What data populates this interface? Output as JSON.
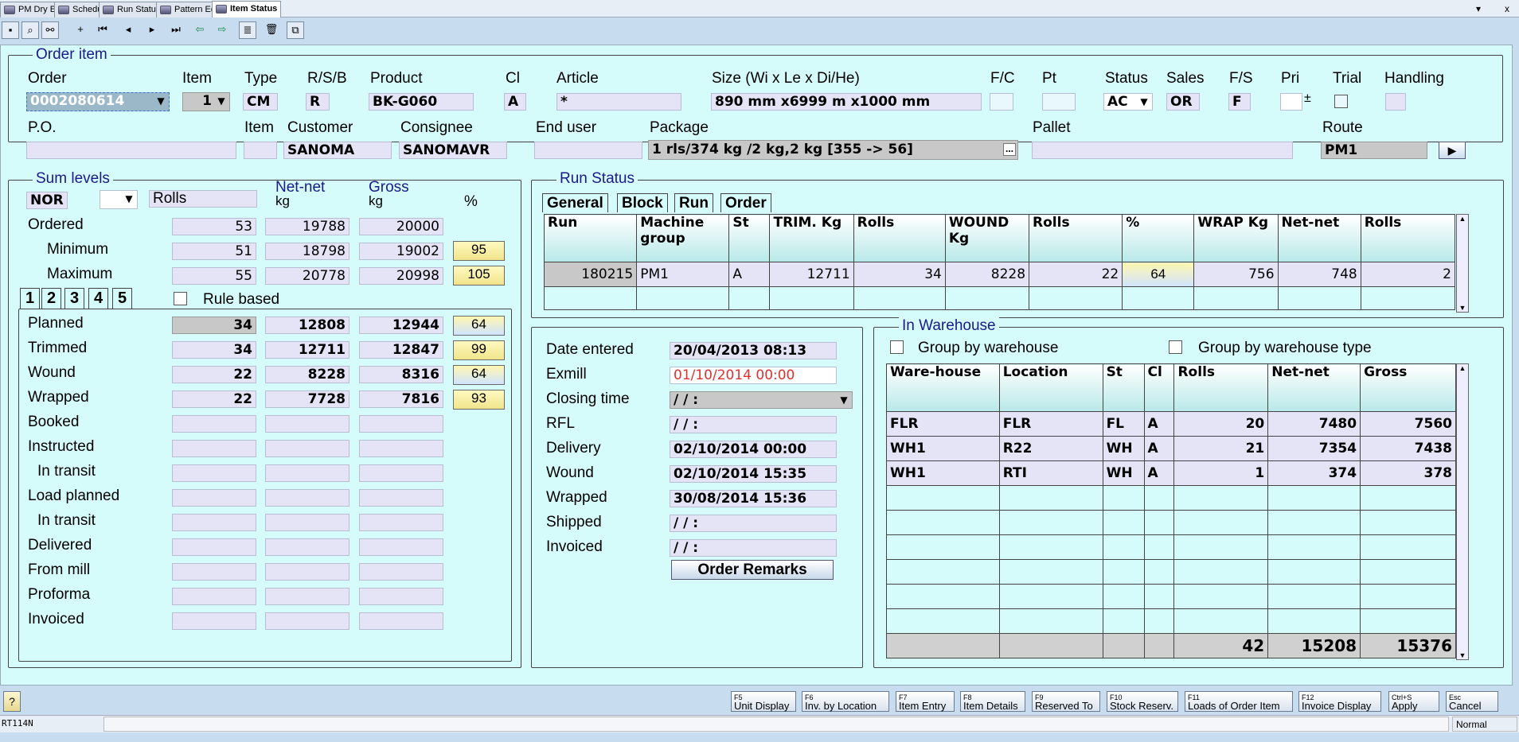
{
  "window_tabs": [
    "PM Dry End",
    "Schedule",
    "Run Status",
    "Pattern Edit",
    "Item Status"
  ],
  "window_controls": [
    "▾",
    "x"
  ],
  "toolbar": {
    "icons": [
      "save-icon",
      "find-icon",
      "binoculars-icon",
      "add-icon",
      "first-icon",
      "prev-icon",
      "next-icon",
      "last-icon",
      "back-icon",
      "forward-icon",
      "report-icon",
      "delete-icon",
      "copy-icon"
    ]
  },
  "order_item": {
    "title": "Order item",
    "labels": {
      "order": "Order",
      "item": "Item",
      "type": "Type",
      "rsb": "R/S/B",
      "product": "Product",
      "cl": "Cl",
      "article": "Article",
      "size": "Size (Wi x Le x Di/He)",
      "fc": "F/C",
      "pt": "Pt",
      "status": "Status",
      "sales": "Sales",
      "fs": "F/S",
      "pri": "Pri",
      "trial": "Trial",
      "handling": "Handling",
      "po": "P.O.",
      "item2": "Item",
      "customer": "Customer",
      "consignee": "Consignee",
      "end_user": "End user",
      "package": "Package",
      "pallet": "Pallet",
      "route": "Route"
    },
    "values": {
      "order": "0002080614",
      "item": "1",
      "type": "CM",
      "rsb": "R",
      "product": "BK-G060",
      "cl": "A",
      "article": "*",
      "size": "890 mm x6999 m x1000 mm",
      "fc": "",
      "pt": "",
      "status": "AC",
      "sales": "OR",
      "fs": "F",
      "pri": "",
      "handling": "",
      "po": "",
      "item2": "",
      "customer": "SANOMA",
      "consignee": "SANOMAVR",
      "end_user": "",
      "package": "1 rls/374 kg /2 kg,2 kg [355 -> 56]",
      "pallet": "",
      "route": "PM1"
    }
  },
  "sum_levels": {
    "title": "Sum levels",
    "code": "NOR",
    "unit": "Rolls",
    "col_netnet": "Net-net",
    "col_gross": "Gross",
    "unit_kg": "kg",
    "col_pct": "%",
    "rows_top": [
      {
        "label": "Ordered",
        "rolls": "53",
        "net": "19788",
        "gross": "20000",
        "pct": ""
      },
      {
        "label": "Minimum",
        "rolls": "51",
        "net": "18798",
        "gross": "19002",
        "pct": "95"
      },
      {
        "label": "Maximum",
        "rolls": "55",
        "net": "20778",
        "gross": "20998",
        "pct": "105"
      }
    ],
    "tabs": [
      "1",
      "2",
      "3",
      "4",
      "5"
    ],
    "rule_based": "Rule based",
    "rows": [
      {
        "label": "Planned",
        "rolls": "34",
        "net": "12808",
        "gross": "12944",
        "pct": "64"
      },
      {
        "label": "Trimmed",
        "rolls": "34",
        "net": "12711",
        "gross": "12847",
        "pct": "99"
      },
      {
        "label": "Wound",
        "rolls": "22",
        "net": "8228",
        "gross": "8316",
        "pct": "64"
      },
      {
        "label": "Wrapped",
        "rolls": "22",
        "net": "7728",
        "gross": "7816",
        "pct": "93"
      },
      {
        "label": "Booked",
        "rolls": "",
        "net": "",
        "gross": "",
        "pct": ""
      },
      {
        "label": "Instructed",
        "rolls": "",
        "net": "",
        "gross": "",
        "pct": ""
      },
      {
        "label": "In transit",
        "rolls": "",
        "net": "",
        "gross": "",
        "pct": ""
      },
      {
        "label": "Load planned",
        "rolls": "",
        "net": "",
        "gross": "",
        "pct": ""
      },
      {
        "label": "In transit",
        "rolls": "",
        "net": "",
        "gross": "",
        "pct": ""
      },
      {
        "label": "Delivered",
        "rolls": "",
        "net": "",
        "gross": "",
        "pct": ""
      },
      {
        "label": "From mill",
        "rolls": "",
        "net": "",
        "gross": "",
        "pct": ""
      },
      {
        "label": "Proforma",
        "rolls": "",
        "net": "",
        "gross": "",
        "pct": ""
      },
      {
        "label": "Invoiced",
        "rolls": "",
        "net": "",
        "gross": "",
        "pct": ""
      }
    ]
  },
  "run_status": {
    "title": "Run Status",
    "tabs": [
      "General",
      "Block",
      "Run",
      "Order"
    ],
    "columns": [
      "Run",
      "Machine group",
      "St",
      "TRIM. Kg",
      "Rolls",
      "WOUND Kg",
      "Rolls",
      "%",
      "WRAP Kg",
      "Net-net",
      "Rolls"
    ],
    "rows": [
      [
        "180215",
        "PM1",
        "A",
        "12711",
        "34",
        "8228",
        "22",
        "64",
        "756",
        "748",
        "2"
      ]
    ]
  },
  "dates": {
    "items": [
      {
        "label": "Date entered",
        "value": "20/04/2013 08:13"
      },
      {
        "label": "Exmill",
        "value": "01/10/2014 00:00"
      },
      {
        "label": "Closing time",
        "value": "/ /        :"
      },
      {
        "label": "RFL",
        "value": "/ /        :"
      },
      {
        "label": "Delivery",
        "value": "02/10/2014 00:00"
      },
      {
        "label": "Wound",
        "value": "02/10/2014 15:35"
      },
      {
        "label": "Wrapped",
        "value": "30/08/2014 15:36"
      },
      {
        "label": "Shipped",
        "value": "/ /        :"
      },
      {
        "label": "Invoiced",
        "value": "/ /        :"
      }
    ],
    "remarks_button": "Order Remarks",
    "exmill_color": "#e03030"
  },
  "warehouse": {
    "title": "In Warehouse",
    "group_by_warehouse": "Group by warehouse",
    "group_by_type": "Group by warehouse type",
    "columns": [
      "Ware-house",
      "Location",
      "St",
      "Cl",
      "Rolls",
      "Net-net",
      "Gross"
    ],
    "rows": [
      [
        "FLR",
        "FLR",
        "FL",
        "A",
        "20",
        "7480",
        "7560"
      ],
      [
        "WH1",
        "R22",
        "WH",
        "A",
        "21",
        "7354",
        "7438"
      ],
      [
        "WH1",
        "RTI",
        "WH",
        "A",
        "1",
        "374",
        "378"
      ]
    ],
    "totals": {
      "rolls": "42",
      "net": "15208",
      "gross": "15376"
    }
  },
  "fkeys": [
    {
      "key": "F5",
      "label": "Unit Display"
    },
    {
      "key": "F6",
      "label": "Inv. by Location"
    },
    {
      "key": "F7",
      "label": "Item Entry"
    },
    {
      "key": "F8",
      "label": "Item Details"
    },
    {
      "key": "F9",
      "label": "Reserved To"
    },
    {
      "key": "F10",
      "label": "Stock Reserv."
    },
    {
      "key": "F11",
      "label": "Loads of Order Item"
    },
    {
      "key": "F12",
      "label": "Invoice Display"
    },
    {
      "key": "Ctrl+S",
      "label": "Apply"
    },
    {
      "key": "Esc",
      "label": "Cancel"
    }
  ],
  "help": "?",
  "status_bar": {
    "left": "RT114N",
    "right": "Normal"
  }
}
